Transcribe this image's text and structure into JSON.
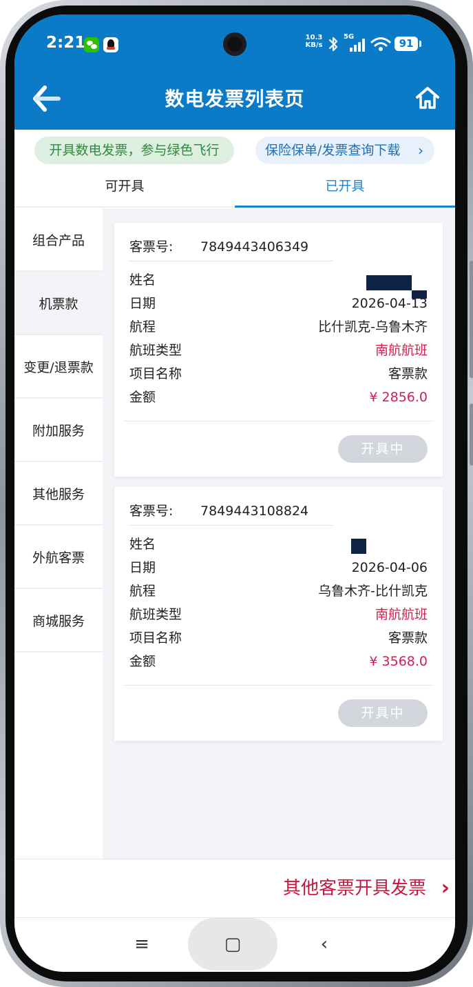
{
  "status_bar": {
    "time": "2:21",
    "net_speed_value": "10.3",
    "net_speed_unit": "KB/s",
    "network": "5G",
    "battery": "91"
  },
  "header": {
    "title": "数电发票列表页",
    "back_icon": "back-arrow-icon",
    "home_icon": "home-icon"
  },
  "banners": {
    "green_pill": "开具数电发票，参与绿色飞行",
    "blue_pill": "保险保单/发票查询下载",
    "blue_pill_chevron": "›"
  },
  "tabs": [
    {
      "label": "可开具",
      "active": false
    },
    {
      "label": "已开具",
      "active": true
    }
  ],
  "sidebar": {
    "items": [
      {
        "label": "组合产品",
        "active": false
      },
      {
        "label": "机票款",
        "active": true
      },
      {
        "label": "变更/退票款",
        "active": false
      },
      {
        "label": "附加服务",
        "active": false
      },
      {
        "label": "其他服务",
        "active": false
      },
      {
        "label": "外航客票",
        "active": false
      },
      {
        "label": "商城服务",
        "active": false
      }
    ]
  },
  "cards": [
    {
      "ticket_no_label": "客票号:",
      "ticket_no": "7849443406349",
      "name_label": "姓名",
      "name": "",
      "date_label": "日期",
      "date": "2026-04-13",
      "route_label": "航程",
      "route": "比什凯克-乌鲁木齐",
      "flight_type_label": "航班类型",
      "flight_type": "南航航班",
      "item_label": "项目名称",
      "item": "客票款",
      "amount_label": "金额",
      "amount": "¥ 2856.0",
      "status": "开具中"
    },
    {
      "ticket_no_label": "客票号:",
      "ticket_no": "7849443108824",
      "name_label": "姓名",
      "name": "",
      "date_label": "日期",
      "date": "2026-04-06",
      "route_label": "航程",
      "route": "乌鲁木齐-比什凯克",
      "flight_type_label": "航班类型",
      "flight_type": "南航航班",
      "item_label": "项目名称",
      "item": "客票款",
      "amount_label": "金额",
      "amount": "¥ 3568.0",
      "status": "开具中"
    }
  ],
  "footer": {
    "link": "其他客票开具发票",
    "arrow": "›"
  },
  "nav_bar": {
    "menu": "≡",
    "home": "▢",
    "back": "‹"
  },
  "colors": {
    "header_blue": "#0b7bc8",
    "accent_red": "#d21f4d",
    "tab_active": "#1a83c9",
    "pill_green_bg": "#dcefe0",
    "status_btn": "#d3d7dd"
  }
}
